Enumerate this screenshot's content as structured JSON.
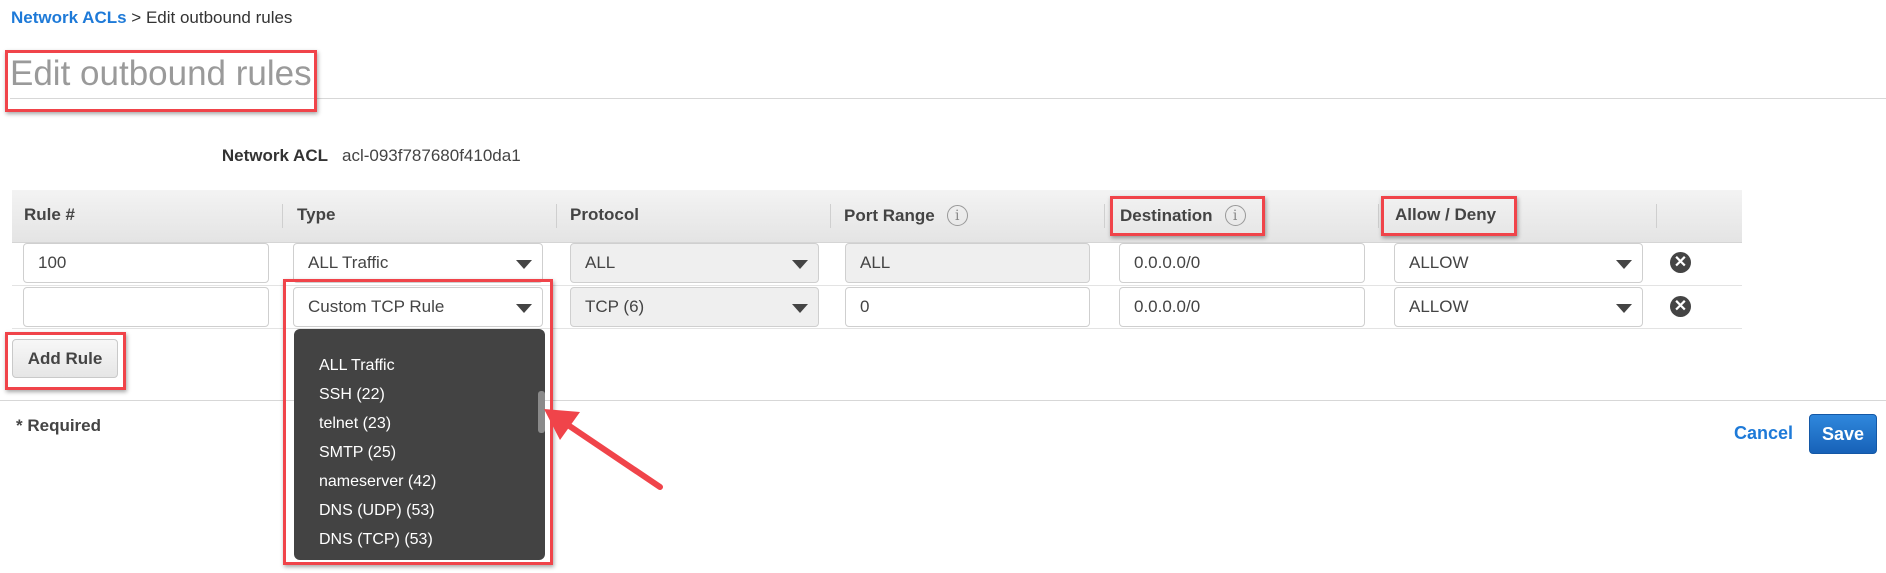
{
  "breadcrumb": {
    "parent_link": "Network ACLs",
    "separator": " > ",
    "current": "Edit outbound rules"
  },
  "page_title": "Edit outbound rules",
  "network_acl": {
    "label": "Network ACL",
    "value": "acl-093f787680f410da1"
  },
  "table": {
    "headers": {
      "rule": "Rule #",
      "type": "Type",
      "protocol": "Protocol",
      "port_range": "Port Range",
      "destination": "Destination",
      "allow_deny": "Allow / Deny"
    },
    "info_icon": "i",
    "rows": [
      {
        "rule": "100",
        "type": "ALL Traffic",
        "protocol": "ALL",
        "port_range": "ALL",
        "destination": "0.0.0.0/0",
        "allow_deny": "ALLOW"
      },
      {
        "rule": "",
        "type": "Custom TCP Rule",
        "protocol": "TCP (6)",
        "port_range": "0",
        "destination": "0.0.0.0/0",
        "allow_deny": "ALLOW"
      }
    ],
    "remove_icon": "✕"
  },
  "type_dropdown": {
    "options": [
      "ALL Traffic",
      "SSH (22)",
      "telnet (23)",
      "SMTP (25)",
      "nameserver (42)",
      "DNS (UDP) (53)",
      "DNS (TCP) (53)"
    ]
  },
  "buttons": {
    "add_rule": "Add Rule",
    "cancel": "Cancel",
    "save": "Save"
  },
  "required_note": "* Required",
  "colors": {
    "link": "#1e7ad8",
    "primary_button": "#1e6fc8",
    "annotation_red": "#f0444a",
    "dropdown_bg": "#434343"
  }
}
